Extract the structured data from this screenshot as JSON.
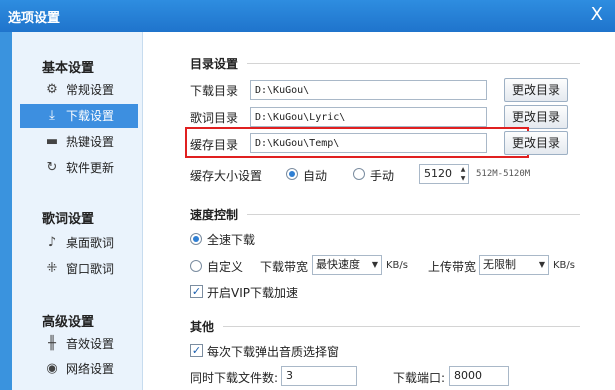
{
  "window": {
    "title": "选项设置",
    "close_glyph": "X"
  },
  "sidebar": {
    "groups": [
      {
        "label": "基本设置"
      },
      {
        "label": "歌词设置"
      },
      {
        "label": "高级设置"
      }
    ],
    "items": [
      {
        "label": "常规设置",
        "icon": "gear-icon"
      },
      {
        "label": "下载设置",
        "icon": "download-icon",
        "active": true
      },
      {
        "label": "热键设置",
        "icon": "keyboard-icon"
      },
      {
        "label": "软件更新",
        "icon": "update-icon"
      },
      {
        "label": "桌面歌词",
        "icon": "desktop-lyric-icon"
      },
      {
        "label": "窗口歌词",
        "icon": "window-lyric-icon"
      },
      {
        "label": "音效设置",
        "icon": "equalizer-icon"
      },
      {
        "label": "网络设置",
        "icon": "network-icon"
      }
    ]
  },
  "directory": {
    "section_title": "目录设置",
    "download_label": "下载目录",
    "download_path": "D:\\KuGou\\",
    "lyric_label": "歌词目录",
    "lyric_path": "D:\\KuGou\\Lyric\\",
    "cache_label": "缓存目录",
    "cache_path": "D:\\KuGou\\Temp\\",
    "change_button": "更改目录",
    "cache_size_label": "缓存大小设置",
    "auto_label": "自动",
    "manual_label": "手动",
    "size_value": "5120",
    "size_hint": "512M-5120M"
  },
  "speed": {
    "section_title": "速度控制",
    "full_speed_label": "全速下载",
    "custom_label": "自定义",
    "download_bw_label": "下载带宽",
    "download_bw_value": "最快速度",
    "kbs": "KB/s",
    "upload_bw_label": "上传带宽",
    "upload_bw_value": "无限制",
    "vip_label": "开启VIP下载加速"
  },
  "other": {
    "section_title": "其他",
    "popup_label": "每次下载弹出音质选择窗",
    "concurrent_label": "同时下载文件数:",
    "concurrent_value": "3",
    "port_label": "下载端口:",
    "port_value": "8000"
  },
  "colors": {
    "titlebar": "#1f74cc",
    "active_item": "#3d8fe0",
    "highlight_box": "#e02020"
  }
}
